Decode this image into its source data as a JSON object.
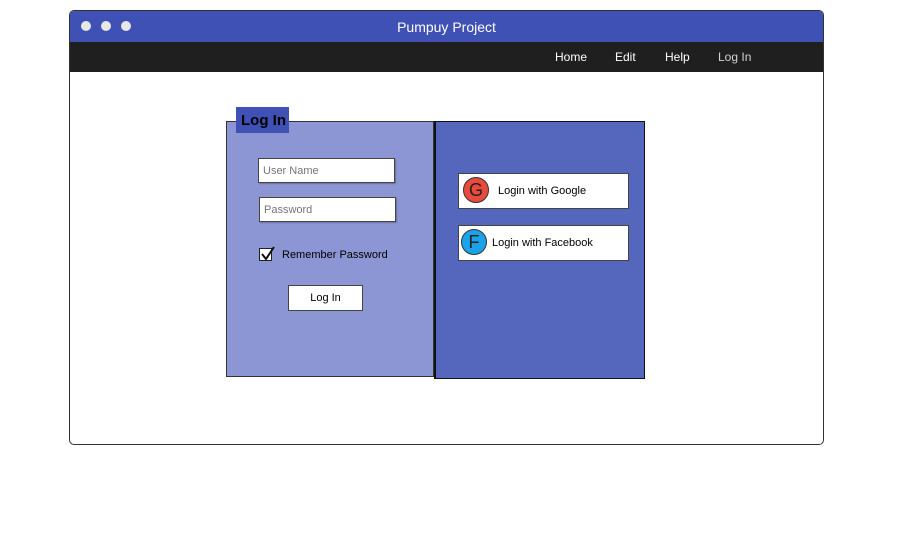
{
  "window": {
    "title": "Pumpuy Project"
  },
  "menu": {
    "items": [
      "Home",
      "Edit",
      "Help",
      "Log In"
    ]
  },
  "login_panel": {
    "label": "Log In",
    "username_placeholder": "User Name",
    "password_placeholder": "Password",
    "remember_label": "Remember Password",
    "remember_checked": true,
    "login_button": "Log In"
  },
  "social": {
    "google": {
      "icon_letter": "G",
      "label": "Login with Google",
      "color": "#e84a3c"
    },
    "facebook": {
      "icon_letter": "F",
      "label": "Login with Facebook",
      "color": "#1aa3e8"
    }
  },
  "colors": {
    "titlebar": "#3f51b5",
    "menubar": "#1f1f1f",
    "panel_left": "#8c96d4",
    "panel_right": "#5566bd"
  }
}
